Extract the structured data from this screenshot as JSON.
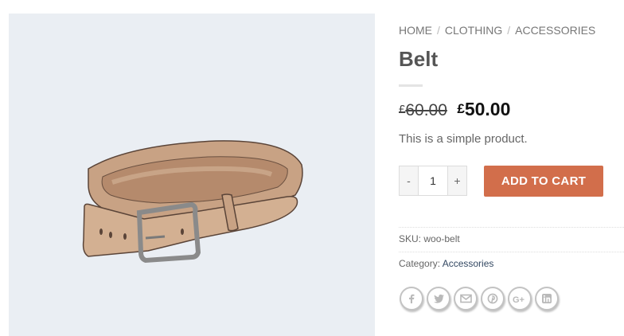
{
  "breadcrumb": {
    "items": [
      "HOME",
      "CLOTHING",
      "ACCESSORIES"
    ],
    "separator": "/"
  },
  "product": {
    "title": "Belt",
    "price": {
      "currency": "£",
      "regular": "60.00",
      "sale": "50.00"
    },
    "short_description": "This is a simple product.",
    "quantity": "1",
    "add_to_cart_label": "ADD TO CART",
    "sku_label": "SKU:",
    "sku_value": "woo-belt",
    "category_label": "Category:",
    "category_value": "Accessories"
  },
  "qty_controls": {
    "minus": "-",
    "plus": "+"
  },
  "share": {
    "icons": [
      "facebook-icon",
      "twitter-icon",
      "email-icon",
      "pinterest-icon",
      "google-plus-icon",
      "linkedin-icon"
    ]
  },
  "colors": {
    "accent": "#d26e4b",
    "gallery_bg": "#eaeef3",
    "link": "#334862"
  }
}
